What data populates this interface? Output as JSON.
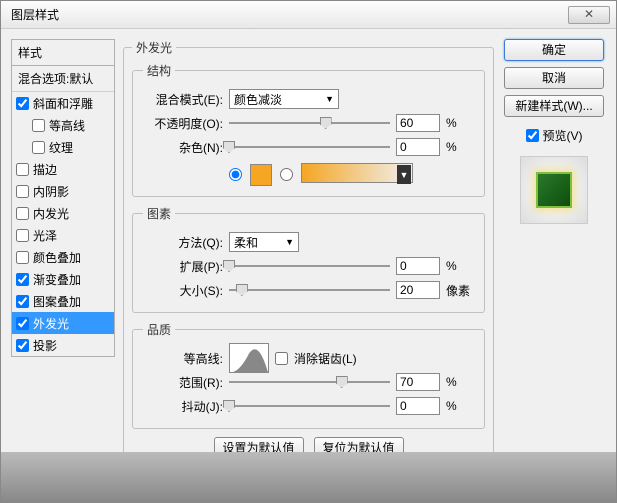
{
  "title": "图层样式",
  "styles_header": "样式",
  "blend_options": "混合选项:默认",
  "styles": [
    {
      "label": "斜面和浮雕",
      "checked": true,
      "indent": false
    },
    {
      "label": "等高线",
      "checked": false,
      "indent": true
    },
    {
      "label": "纹理",
      "checked": false,
      "indent": true
    },
    {
      "label": "描边",
      "checked": false,
      "indent": false
    },
    {
      "label": "内阴影",
      "checked": false,
      "indent": false
    },
    {
      "label": "内发光",
      "checked": false,
      "indent": false
    },
    {
      "label": "光泽",
      "checked": false,
      "indent": false
    },
    {
      "label": "颜色叠加",
      "checked": false,
      "indent": false
    },
    {
      "label": "渐变叠加",
      "checked": true,
      "indent": false
    },
    {
      "label": "图案叠加",
      "checked": true,
      "indent": false
    },
    {
      "label": "外发光",
      "checked": true,
      "indent": false,
      "selected": true
    },
    {
      "label": "投影",
      "checked": true,
      "indent": false
    }
  ],
  "panel_title": "外发光",
  "structure": {
    "legend": "结构",
    "blend_mode_label": "混合模式(E):",
    "blend_mode_value": "颜色减淡",
    "opacity_label": "不透明度(O):",
    "opacity_value": "60",
    "opacity_unit": "%",
    "noise_label": "杂色(N):",
    "noise_value": "0",
    "noise_unit": "%"
  },
  "elements": {
    "legend": "图素",
    "technique_label": "方法(Q):",
    "technique_value": "柔和",
    "spread_label": "扩展(P):",
    "spread_value": "0",
    "spread_unit": "%",
    "size_label": "大小(S):",
    "size_value": "20",
    "size_unit": "像素"
  },
  "quality": {
    "legend": "品质",
    "contour_label": "等高线:",
    "antialias_label": "消除锯齿(L)",
    "range_label": "范围(R):",
    "range_value": "70",
    "range_unit": "%",
    "jitter_label": "抖动(J):",
    "jitter_value": "0",
    "jitter_unit": "%"
  },
  "defaults": {
    "set": "设置为默认值",
    "reset": "复位为默认值"
  },
  "buttons": {
    "ok": "确定",
    "cancel": "取消",
    "new_style": "新建样式(W)...",
    "preview": "预览(V)"
  }
}
